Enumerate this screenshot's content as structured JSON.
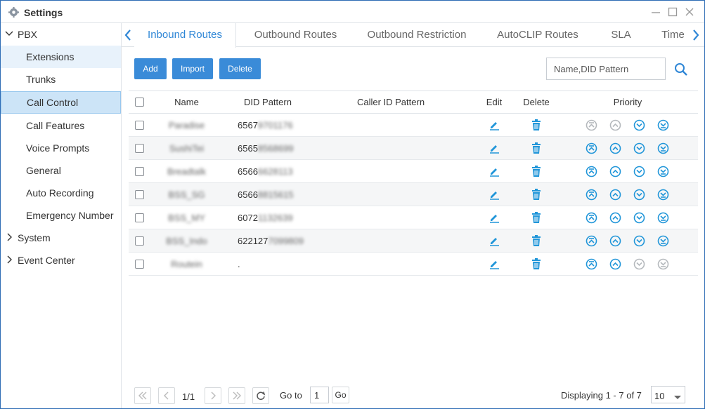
{
  "window": {
    "title": "Settings"
  },
  "sidebar": {
    "items": [
      {
        "label": "PBX"
      },
      {
        "label": "Extensions"
      },
      {
        "label": "Trunks"
      },
      {
        "label": "Call Control"
      },
      {
        "label": "Call Features"
      },
      {
        "label": "Voice Prompts"
      },
      {
        "label": "General"
      },
      {
        "label": "Auto Recording"
      },
      {
        "label": "Emergency Number"
      },
      {
        "label": "System"
      },
      {
        "label": "Event Center"
      }
    ]
  },
  "tabs": [
    {
      "label": "Inbound Routes"
    },
    {
      "label": "Outbound Routes"
    },
    {
      "label": "Outbound Restriction"
    },
    {
      "label": "AutoCLIP Routes"
    },
    {
      "label": "SLA"
    },
    {
      "label": "Time"
    }
  ],
  "toolbar": {
    "add": "Add",
    "import": "Import",
    "delete": "Delete",
    "search_placeholder": "Name,DID Pattern"
  },
  "table": {
    "headers": {
      "name": "Name",
      "did": "DID Pattern",
      "caller": "Caller ID Pattern",
      "edit": "Edit",
      "delete": "Delete",
      "priority": "Priority"
    },
    "rows": [
      {
        "name": "Paradise",
        "did_visible": "6567",
        "did_hidden": "9701176"
      },
      {
        "name": "SushiTei",
        "did_visible": "6565",
        "did_hidden": "8568699"
      },
      {
        "name": "Breadtalk",
        "did_visible": "6566",
        "did_hidden": "6628113"
      },
      {
        "name": "BSS_SG",
        "did_visible": "6566",
        "did_hidden": "8815615"
      },
      {
        "name": "BSS_MY",
        "did_visible": "6072",
        "did_hidden": "1132639"
      },
      {
        "name": "BSS_Indo",
        "did_visible": "622127",
        "did_hidden": "7099809"
      },
      {
        "name": "Routein",
        "did_visible": ".",
        "did_hidden": ""
      }
    ]
  },
  "pager": {
    "page": "1/1",
    "goto_label": "Go to",
    "goto_value": "1",
    "go": "Go",
    "displaying": "Displaying 1 - 7 of 7",
    "page_size": "10"
  },
  "colors": {
    "accent": "#2e86d6",
    "button": "#3a8bd8",
    "icon": "#2196d9",
    "disabled": "#b5b9bd"
  }
}
